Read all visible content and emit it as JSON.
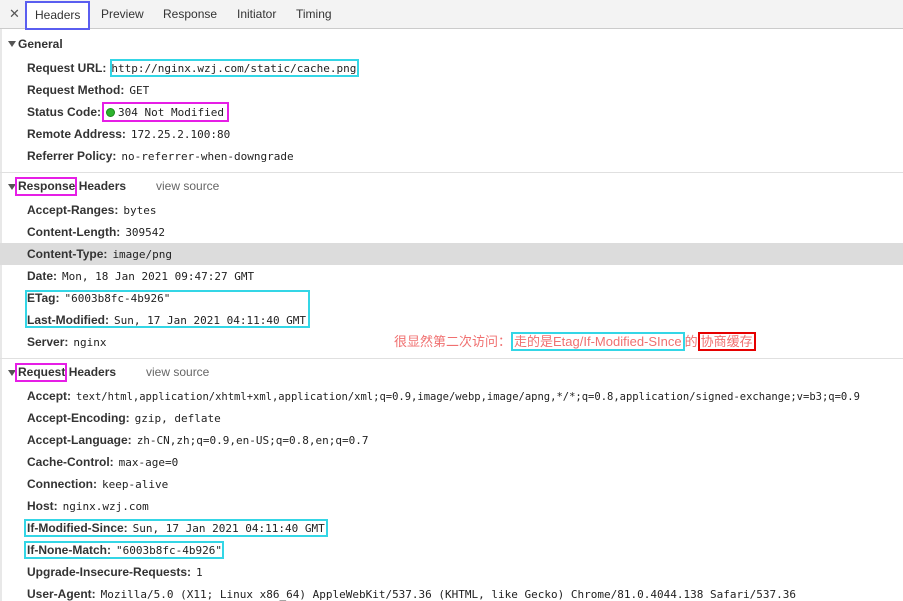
{
  "tabs": {
    "close": "✕",
    "items": [
      "Headers",
      "Preview",
      "Response",
      "Initiator",
      "Timing"
    ]
  },
  "general": {
    "title": "General",
    "rows": [
      {
        "key": "Request URL:",
        "value": "http://nginx.wzj.com/static/cache.png"
      },
      {
        "key": "Request Method:",
        "value": "GET"
      },
      {
        "key": "Status Code:",
        "value": "304 Not Modified"
      },
      {
        "key": "Remote Address:",
        "value": "172.25.2.100:80"
      },
      {
        "key": "Referrer Policy:",
        "value": "no-referrer-when-downgrade"
      }
    ]
  },
  "response": {
    "title_a": "Response",
    "title_b": "Headers",
    "view_source": "view source",
    "rows": [
      {
        "key": "Accept-Ranges:",
        "value": "bytes"
      },
      {
        "key": "Content-Length:",
        "value": "309542"
      },
      {
        "key": "Content-Type:",
        "value": "image/png"
      },
      {
        "key": "Date:",
        "value": "Mon, 18 Jan 2021 09:47:27 GMT"
      },
      {
        "key": "ETag:",
        "value": "\"6003b8fc-4b926\""
      },
      {
        "key": "Last-Modified:",
        "value": "Sun, 17 Jan 2021 04:11:40 GMT"
      },
      {
        "key": "Server:",
        "value": "nginx"
      }
    ]
  },
  "annotation": {
    "part1": "很显然第二次访问：",
    "part2": "走的是Etag/If-Modified-SInce",
    "part3": "的",
    "part4": "协商缓存"
  },
  "request": {
    "title_a": "Request",
    "title_b": "Headers",
    "view_source": "view source",
    "rows": [
      {
        "key": "Accept:",
        "value": "text/html,application/xhtml+xml,application/xml;q=0.9,image/webp,image/apng,*/*;q=0.8,application/signed-exchange;v=b3;q=0.9"
      },
      {
        "key": "Accept-Encoding:",
        "value": "gzip, deflate"
      },
      {
        "key": "Accept-Language:",
        "value": "zh-CN,zh;q=0.9,en-US;q=0.8,en;q=0.7"
      },
      {
        "key": "Cache-Control:",
        "value": "max-age=0"
      },
      {
        "key": "Connection:",
        "value": "keep-alive"
      },
      {
        "key": "Host:",
        "value": "nginx.wzj.com"
      },
      {
        "key": "If-Modified-Since:",
        "value": "Sun, 17 Jan 2021 04:11:40 GMT"
      },
      {
        "key": "If-None-Match:",
        "value": "\"6003b8fc-4b926\""
      },
      {
        "key": "Upgrade-Insecure-Requests:",
        "value": "1"
      },
      {
        "key": "User-Agent:",
        "value": "Mozilla/5.0 (X11; Linux x86_64) AppleWebKit/537.36 (KHTML, like Gecko) Chrome/81.0.4044.138 Safari/537.36"
      }
    ]
  },
  "colors": {
    "tab_focus": "#5a5ef0",
    "highlight_cyan": "#34d6e6",
    "highlight_magenta": "#e61ee6",
    "highlight_red": "#e60000",
    "annotation_text": "#f07070",
    "status_ok": "#2db32d"
  }
}
